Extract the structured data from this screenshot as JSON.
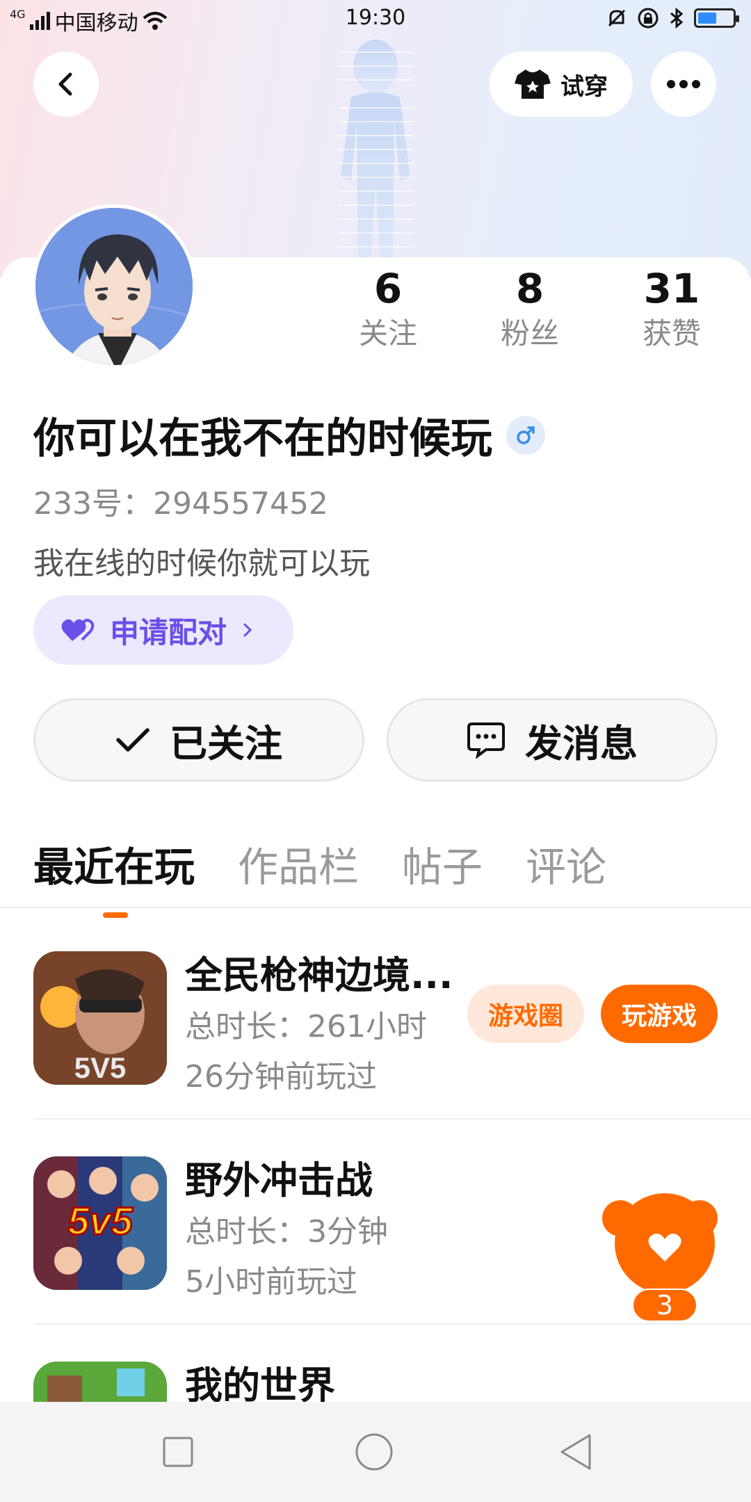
{
  "status_bar": {
    "carrier": "中国移动",
    "network": "4G",
    "time": "19:30"
  },
  "header": {
    "tryon_label": "试穿"
  },
  "profile": {
    "name": "你可以在我不在的时候玩",
    "gender": "male",
    "uid_text": "233号：294557452",
    "bio": "我在线的时候你就可以玩",
    "pair_label": "申请配对",
    "stats": [
      {
        "value": "6",
        "label": "关注"
      },
      {
        "value": "8",
        "label": "粉丝"
      },
      {
        "value": "31",
        "label": "获赞"
      }
    ],
    "following_label": "已关注",
    "message_label": "发消息"
  },
  "tabs": [
    "最近在玩",
    "作品栏",
    "帖子",
    "评论"
  ],
  "games": [
    {
      "title": "全民枪神边境...",
      "duration": "总时长：261小时",
      "last_played": "26分钟前玩过",
      "circle_label": "游戏圈",
      "play_label": "玩游戏"
    },
    {
      "title": "野外冲击战",
      "duration": "总时长：3分钟",
      "last_played": "5小时前玩过"
    },
    {
      "title": "我的世界"
    }
  ],
  "floating_like": {
    "count": "3"
  },
  "colors": {
    "accent": "#ff6a00",
    "pair_purple": "#6a4fe8",
    "gender_blue": "#3a8de8"
  }
}
